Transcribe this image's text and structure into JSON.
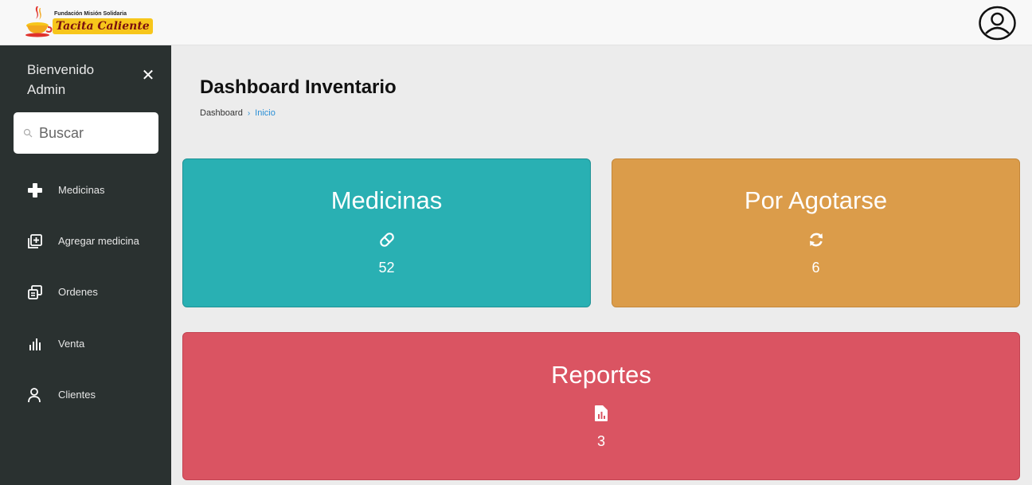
{
  "header": {
    "logo_line1": "Fundación Misión Solidaria",
    "logo_brand": "Tacita Caliente",
    "avatar_icon": "user-circle-icon"
  },
  "sidebar": {
    "welcome": "Bienvenido Admin",
    "close_icon": "close-icon",
    "search_placeholder": "Buscar",
    "items": [
      {
        "label": "Medicinas",
        "icon": "plus-icon"
      },
      {
        "label": "Agregar medicina",
        "icon": "add-box-icon"
      },
      {
        "label": "Ordenes",
        "icon": "orders-icon"
      },
      {
        "label": "Venta",
        "icon": "bar-chart-icon"
      },
      {
        "label": "Clientes",
        "icon": "user-icon"
      }
    ]
  },
  "main": {
    "title": "Dashboard Inventario",
    "breadcrumb": {
      "root": "Dashboard",
      "separator": "›",
      "current": "Inicio"
    },
    "cards": [
      {
        "title": "Medicinas",
        "count": "52",
        "icon": "pill-icon",
        "color": "#29b0b3"
      },
      {
        "title": "Por Agotarse",
        "count": "6",
        "icon": "refresh-icon",
        "color": "#db9c4a"
      },
      {
        "title": "Reportes",
        "count": "3",
        "icon": "report-file-icon",
        "color": "#da5462"
      }
    ]
  }
}
